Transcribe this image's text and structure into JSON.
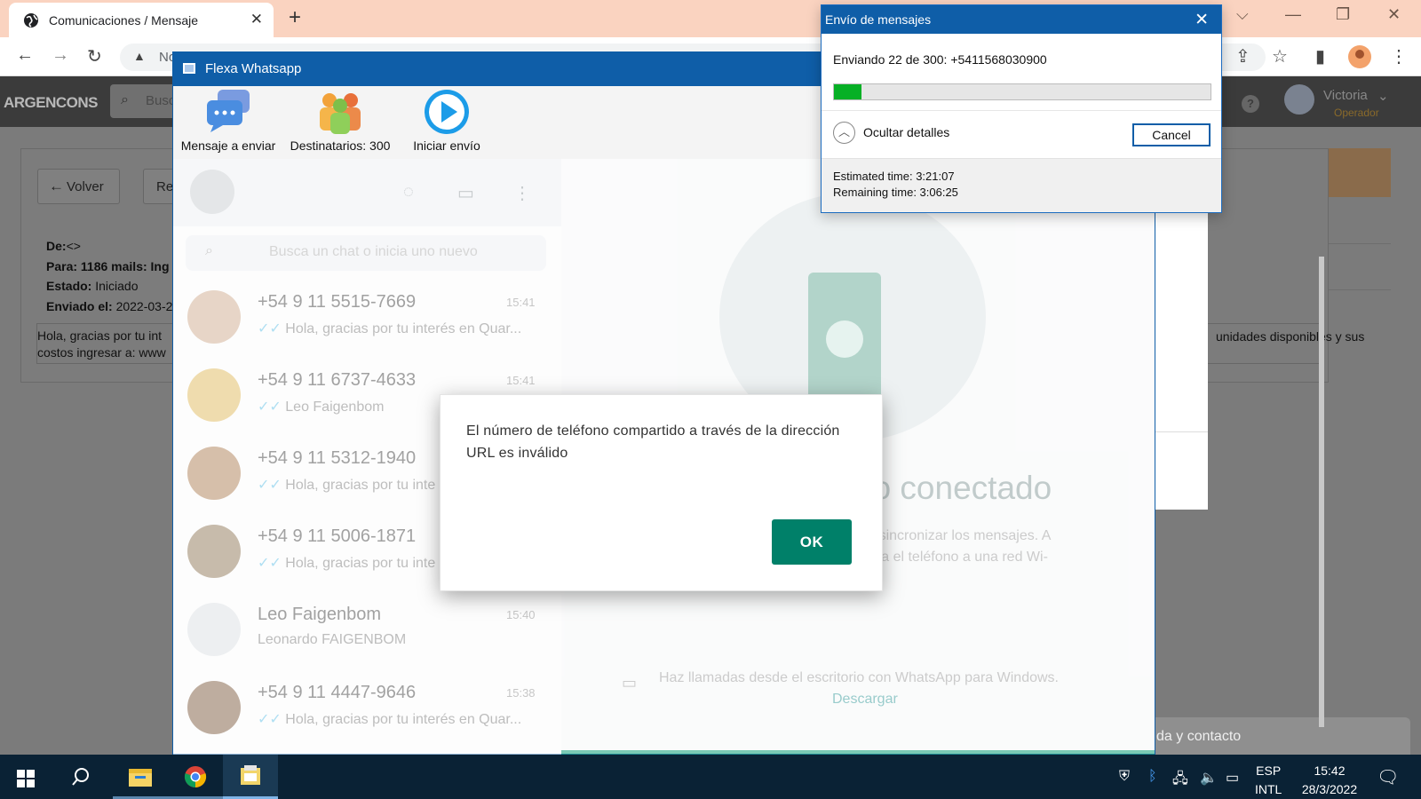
{
  "browser": {
    "tab_title": "Comunicaciones / Mensaje",
    "url_partial": "No"
  },
  "app": {
    "logo": "ARGENCONS",
    "search_partial": "Busc",
    "user_name": "Victoria",
    "user_role": "Operador",
    "back_label": "Volver",
    "second_button_partial": "Re",
    "meta": {
      "from_label": "De:",
      "from_value": "<>",
      "to_label": "Para:",
      "to_value": "1186 mails: Ing",
      "state_label": "Estado:",
      "state_value": "Iniciado",
      "sent_label": "Enviado el:",
      "sent_value": "2022-03-2"
    },
    "message_line1": "Hola, gracias por tu int",
    "message_line2": "costos ingresar a: www",
    "message_right": "unidades disponibles y sus",
    "chat_footer_partial": "da y contacto"
  },
  "flexa": {
    "window_title": "Flexa Whatsapp",
    "tools": [
      {
        "label": "Mensaje a enviar",
        "icon": "message-bubbles-icon"
      },
      {
        "label": "Destinatarios: 300",
        "icon": "people-group-icon"
      },
      {
        "label": "Iniciar envío",
        "icon": "play-icon"
      }
    ]
  },
  "whatsapp": {
    "search_placeholder": "Busca un chat o inicia uno nuevo",
    "chats": [
      {
        "name": "+54 9 11 5515-7669",
        "time": "15:41",
        "preview": "Hola, gracias por tu interés en Quar...",
        "avatar_color": "#d4b49a"
      },
      {
        "name": "+54 9 11 6737-4633",
        "time": "15:41",
        "preview": "Leo Faigenbom",
        "avatar_color": "#e2c06c"
      },
      {
        "name": "+54 9 11 5312-1940",
        "time": "",
        "preview": "Hola, gracias por tu inte",
        "avatar_color": "#b58b66"
      },
      {
        "name": "+54 9 11 5006-1871",
        "time": "",
        "preview": "Hola, gracias por tu inte",
        "avatar_color": "#9a8468"
      },
      {
        "name": "Leo Faigenbom",
        "time": "15:40",
        "preview": "Leonardo FAIGENBOM",
        "avatar_color": "#dfe3e6"
      },
      {
        "name": "+54 9 11 4447-9646",
        "time": "15:38",
        "preview": "Hola, gracias por tu interés en Quar...",
        "avatar_color": "#8a6b52"
      }
    ],
    "disconnected_partial": "no conectado",
    "para_line1": "ara sincronizar los mensajes. A",
    "para_line2": "necta el teléfono a una red Wi-",
    "download_text": "Haz llamadas desde el escritorio con WhatsApp para Windows.",
    "download_link": "Descargar"
  },
  "error_dialog": {
    "message": "El número de teléfono compartido a través de la dirección URL es inválido",
    "ok_label": "OK"
  },
  "sending_dialog": {
    "title": "Envío de mensajes",
    "status": "Enviando 22 de 300: +5411568030900",
    "progress_fraction": 0.0733,
    "details_label": "Ocultar detalles",
    "cancel_label": "Cancel",
    "estimated": "Estimated time: 3:21:07",
    "remaining": "Remaining time: 3:06:25"
  },
  "taskbar": {
    "lang_line1": "ESP",
    "lang_line2": "INTL",
    "time": "15:42",
    "date": "28/3/2022"
  }
}
